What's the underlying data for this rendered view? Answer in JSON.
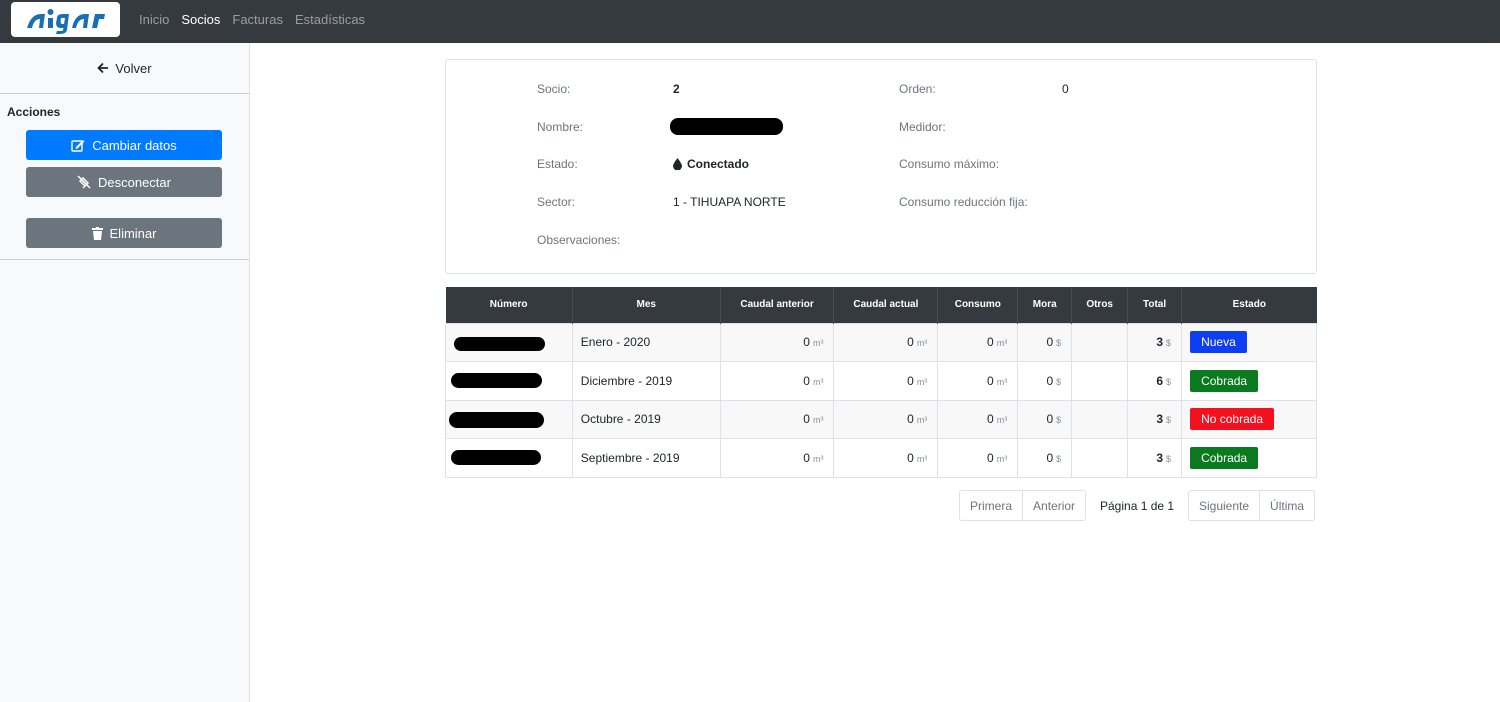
{
  "app": {
    "logo_text": "aigar"
  },
  "nav": {
    "links": [
      "Inicio",
      "Socios",
      "Facturas",
      "Estadísticas"
    ],
    "active": "Socios"
  },
  "sidebar": {
    "back_label": "Volver",
    "actions_title": "Acciones",
    "buttons": {
      "edit": "Cambiar datos",
      "disconnect": "Desconectar",
      "delete": "Eliminar"
    }
  },
  "socio": {
    "labels": {
      "socio": "Socio:",
      "nombre": "Nombre:",
      "estado": "Estado:",
      "sector": "Sector:",
      "observaciones": "Observaciones:",
      "orden": "Orden:",
      "medidor": "Medidor:",
      "consumo_maximo": "Consumo máximo:",
      "consumo_reduccion": "Consumo reducción fija:"
    },
    "values": {
      "socio": "2",
      "estado": "Conectado",
      "sector": "1 - TIHUAPA NORTE",
      "orden": "0"
    }
  },
  "table": {
    "headers": [
      "Número",
      "Mes",
      "Caudal anterior",
      "Caudal actual",
      "Consumo",
      "Mora",
      "Otros",
      "Total",
      "Estado"
    ],
    "unit_m3": "m³",
    "unit_currency": "$",
    "rows": [
      {
        "mes": "Enero - 2020",
        "caudal_anterior": "0",
        "caudal_actual": "0",
        "consumo": "0",
        "mora": "0",
        "total": "3",
        "estado": "Nueva",
        "estado_color": "#0d3ef2"
      },
      {
        "mes": "Diciembre - 2019",
        "caudal_anterior": "0",
        "caudal_actual": "0",
        "consumo": "0",
        "mora": "0",
        "total": "6",
        "estado": "Cobrada",
        "estado_color": "#0a7a1e"
      },
      {
        "mes": "Octubre - 2019",
        "caudal_anterior": "0",
        "caudal_actual": "0",
        "consumo": "0",
        "mora": "0",
        "total": "3",
        "estado": "No cobrada",
        "estado_color": "#f5101f"
      },
      {
        "mes": "Septiembre - 2019",
        "caudal_anterior": "0",
        "caudal_actual": "0",
        "consumo": "0",
        "mora": "0",
        "total": "3",
        "estado": "Cobrada",
        "estado_color": "#0a7a1e"
      }
    ]
  },
  "pagination": {
    "first": "Primera",
    "prev": "Anterior",
    "info": "Página 1 de 1",
    "next": "Siguiente",
    "last": "Última"
  },
  "colors": {
    "navbar": "#343a40",
    "primary": "#007bff",
    "secondary": "#6c757d",
    "logo": "#1a6fb3"
  }
}
